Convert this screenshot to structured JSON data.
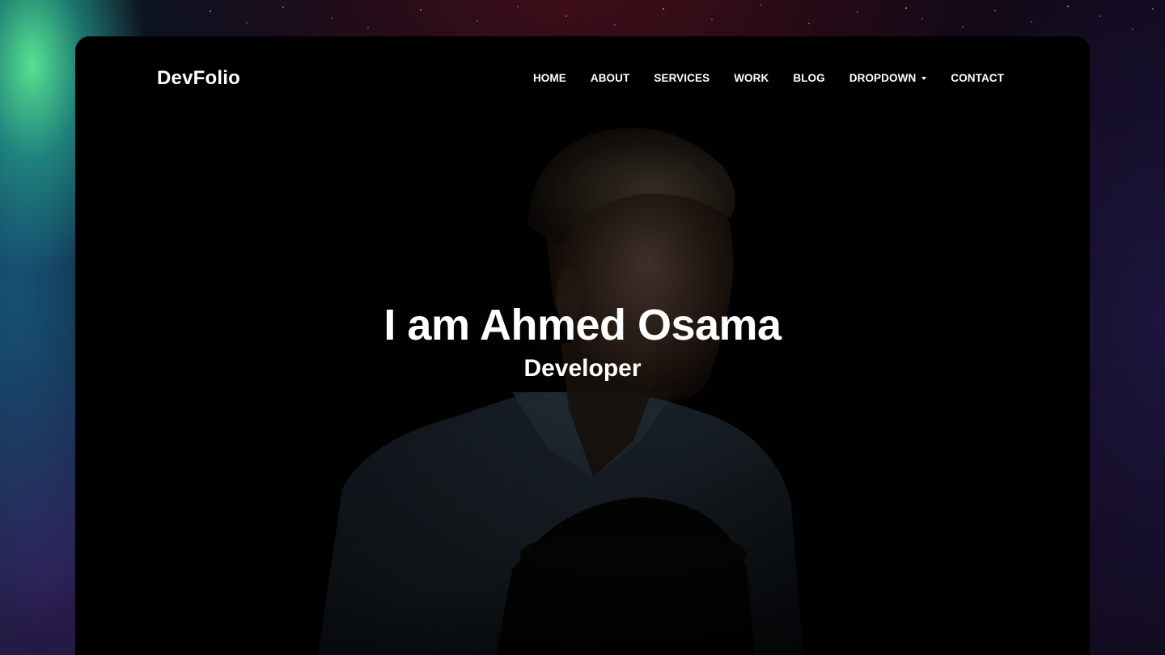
{
  "site": {
    "brand": "DevFolio"
  },
  "nav": {
    "items": [
      {
        "label": "HOME"
      },
      {
        "label": "ABOUT"
      },
      {
        "label": "SERVICES"
      },
      {
        "label": "WORK"
      },
      {
        "label": "BLOG"
      },
      {
        "label": "DROPDOWN",
        "has_caret": true
      },
      {
        "label": "CONTACT"
      }
    ]
  },
  "hero": {
    "title": "I am Ahmed Osama",
    "subtitle": "Developer"
  },
  "colors": {
    "text": "#ffffff",
    "page_background": "#000000",
    "accent_glow_green": "#5aeb96"
  },
  "icons": {
    "dropdown": "caret-down-icon"
  }
}
